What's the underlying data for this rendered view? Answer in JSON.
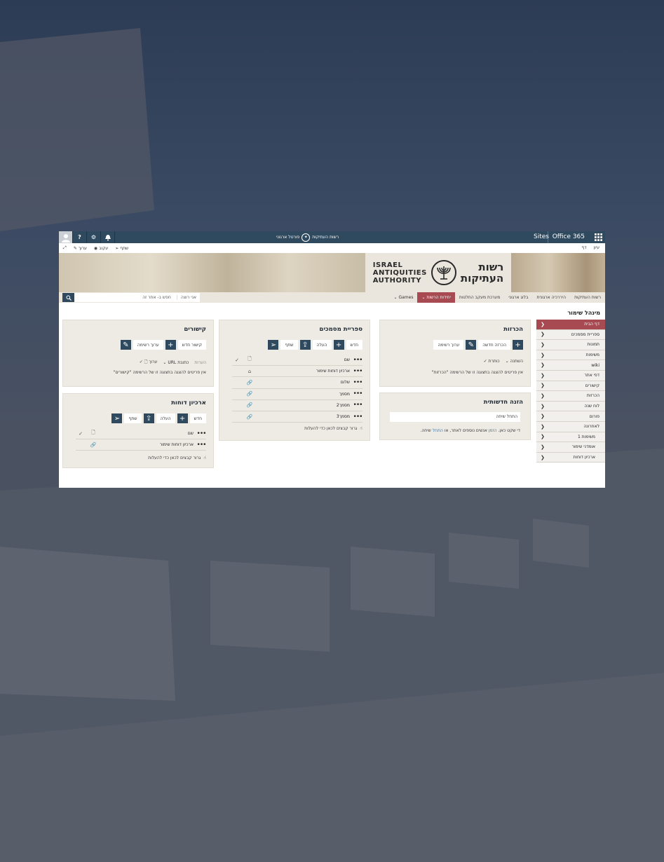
{
  "topbar": {
    "office": "Office 365",
    "sites": "Sites",
    "portal_label": "פורטל ארגוני",
    "portal_org": "רשות העתיקות",
    "help": "?",
    "settings": "⚙"
  },
  "cmdbar": {
    "browse": "עיון",
    "page": "דף",
    "share": "שתף",
    "follow": "עקוב",
    "edit": "ערוך"
  },
  "banner": {
    "logo_en_1": "ISRAEL",
    "logo_en_2": "ANTIQUITIES",
    "logo_en_3": "AUTHORITY",
    "logo_he_1": "רשות",
    "logo_he_2": "העתיקות"
  },
  "nav": {
    "items": [
      "רשות העתיקות",
      "היררכיה ארגונית",
      "בלוג ארגוני",
      "מערכת מעקב החלטות",
      "יחידות הרשות",
      "Games"
    ],
    "search_scope": "אני רוצה",
    "search_placeholder": "חפש ב- אתר זה"
  },
  "page": {
    "title": "מינהל שימור"
  },
  "quicklaunch": {
    "items": [
      "דף הבית",
      "ספריית מסמכים",
      "תמונות",
      "משימות",
      "wiki",
      "דפי אתר",
      "קישורים",
      "הכרזות",
      "לוח שנה",
      "פורום",
      "לאחרונה",
      "משימות 1",
      "אומדני שימור",
      "ארכיון דוחות"
    ]
  },
  "announcements": {
    "title": "הכרזות",
    "new_label": "הכרזה חדשה",
    "edit_label": "ערוך רשימה",
    "col_modified": "השתנה",
    "col_title": "כותרת",
    "empty": "אין פריטים להצגה בתצוגה זו של הרשימה \"הכרזות\""
  },
  "newsfeed": {
    "title": "הזנה חדשותית",
    "input": "התחל שיחה",
    "text_1": "די שקט כאן.",
    "link_1": "הזמן",
    "text_2": "אנשים נוספים לאתר, או",
    "link_2": "התחל",
    "text_3": "שיחה."
  },
  "doclib": {
    "title": "ספריית מסמכים",
    "new_label": "חדש",
    "upload_label": "העלה",
    "share_label": "שתף",
    "col_name": "שם",
    "rows": [
      "ארכיון דוחות שימור",
      "שלום",
      "מסמך",
      "מסמך2",
      "מסמך3"
    ],
    "drag": "גרור קבצים לכאן כדי להעלות"
  },
  "links": {
    "title": "קישורים",
    "new_label": "קישור חדש",
    "edit_label": "ערוך רשימה",
    "col_notes": "הערות",
    "col_url": "כתובת URL",
    "col_edit": "ערוך",
    "empty": "אין פריטים להצגה בתצוגה זו של הרשימה \"קישורים\""
  },
  "reports": {
    "title": "ארכיון דוחות",
    "new_label": "חדש",
    "upload_label": "העלה",
    "share_label": "שתף",
    "col_name": "שם",
    "rows": [
      "ארכיון דוחות שימור"
    ],
    "drag": "גרור קבצים לכאן כדי להעלות"
  }
}
